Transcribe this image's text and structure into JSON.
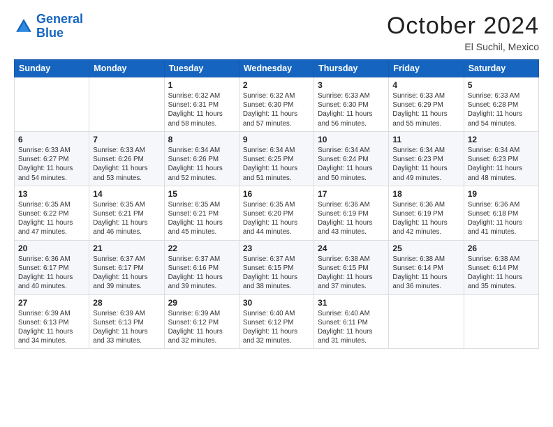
{
  "header": {
    "logo_line1": "General",
    "logo_line2": "Blue",
    "month": "October 2024",
    "location": "El Suchil, Mexico"
  },
  "days_of_week": [
    "Sunday",
    "Monday",
    "Tuesday",
    "Wednesday",
    "Thursday",
    "Friday",
    "Saturday"
  ],
  "weeks": [
    [
      {
        "day": "",
        "empty": true
      },
      {
        "day": "",
        "empty": true
      },
      {
        "day": "1",
        "sunrise": "Sunrise: 6:32 AM",
        "sunset": "Sunset: 6:31 PM",
        "daylight": "Daylight: 11 hours and 58 minutes."
      },
      {
        "day": "2",
        "sunrise": "Sunrise: 6:32 AM",
        "sunset": "Sunset: 6:30 PM",
        "daylight": "Daylight: 11 hours and 57 minutes."
      },
      {
        "day": "3",
        "sunrise": "Sunrise: 6:33 AM",
        "sunset": "Sunset: 6:30 PM",
        "daylight": "Daylight: 11 hours and 56 minutes."
      },
      {
        "day": "4",
        "sunrise": "Sunrise: 6:33 AM",
        "sunset": "Sunset: 6:29 PM",
        "daylight": "Daylight: 11 hours and 55 minutes."
      },
      {
        "day": "5",
        "sunrise": "Sunrise: 6:33 AM",
        "sunset": "Sunset: 6:28 PM",
        "daylight": "Daylight: 11 hours and 54 minutes."
      }
    ],
    [
      {
        "day": "6",
        "sunrise": "Sunrise: 6:33 AM",
        "sunset": "Sunset: 6:27 PM",
        "daylight": "Daylight: 11 hours and 54 minutes."
      },
      {
        "day": "7",
        "sunrise": "Sunrise: 6:33 AM",
        "sunset": "Sunset: 6:26 PM",
        "daylight": "Daylight: 11 hours and 53 minutes."
      },
      {
        "day": "8",
        "sunrise": "Sunrise: 6:34 AM",
        "sunset": "Sunset: 6:26 PM",
        "daylight": "Daylight: 11 hours and 52 minutes."
      },
      {
        "day": "9",
        "sunrise": "Sunrise: 6:34 AM",
        "sunset": "Sunset: 6:25 PM",
        "daylight": "Daylight: 11 hours and 51 minutes."
      },
      {
        "day": "10",
        "sunrise": "Sunrise: 6:34 AM",
        "sunset": "Sunset: 6:24 PM",
        "daylight": "Daylight: 11 hours and 50 minutes."
      },
      {
        "day": "11",
        "sunrise": "Sunrise: 6:34 AM",
        "sunset": "Sunset: 6:23 PM",
        "daylight": "Daylight: 11 hours and 49 minutes."
      },
      {
        "day": "12",
        "sunrise": "Sunrise: 6:34 AM",
        "sunset": "Sunset: 6:23 PM",
        "daylight": "Daylight: 11 hours and 48 minutes."
      }
    ],
    [
      {
        "day": "13",
        "sunrise": "Sunrise: 6:35 AM",
        "sunset": "Sunset: 6:22 PM",
        "daylight": "Daylight: 11 hours and 47 minutes."
      },
      {
        "day": "14",
        "sunrise": "Sunrise: 6:35 AM",
        "sunset": "Sunset: 6:21 PM",
        "daylight": "Daylight: 11 hours and 46 minutes."
      },
      {
        "day": "15",
        "sunrise": "Sunrise: 6:35 AM",
        "sunset": "Sunset: 6:21 PM",
        "daylight": "Daylight: 11 hours and 45 minutes."
      },
      {
        "day": "16",
        "sunrise": "Sunrise: 6:35 AM",
        "sunset": "Sunset: 6:20 PM",
        "daylight": "Daylight: 11 hours and 44 minutes."
      },
      {
        "day": "17",
        "sunrise": "Sunrise: 6:36 AM",
        "sunset": "Sunset: 6:19 PM",
        "daylight": "Daylight: 11 hours and 43 minutes."
      },
      {
        "day": "18",
        "sunrise": "Sunrise: 6:36 AM",
        "sunset": "Sunset: 6:19 PM",
        "daylight": "Daylight: 11 hours and 42 minutes."
      },
      {
        "day": "19",
        "sunrise": "Sunrise: 6:36 AM",
        "sunset": "Sunset: 6:18 PM",
        "daylight": "Daylight: 11 hours and 41 minutes."
      }
    ],
    [
      {
        "day": "20",
        "sunrise": "Sunrise: 6:36 AM",
        "sunset": "Sunset: 6:17 PM",
        "daylight": "Daylight: 11 hours and 40 minutes."
      },
      {
        "day": "21",
        "sunrise": "Sunrise: 6:37 AM",
        "sunset": "Sunset: 6:17 PM",
        "daylight": "Daylight: 11 hours and 39 minutes."
      },
      {
        "day": "22",
        "sunrise": "Sunrise: 6:37 AM",
        "sunset": "Sunset: 6:16 PM",
        "daylight": "Daylight: 11 hours and 39 minutes."
      },
      {
        "day": "23",
        "sunrise": "Sunrise: 6:37 AM",
        "sunset": "Sunset: 6:15 PM",
        "daylight": "Daylight: 11 hours and 38 minutes."
      },
      {
        "day": "24",
        "sunrise": "Sunrise: 6:38 AM",
        "sunset": "Sunset: 6:15 PM",
        "daylight": "Daylight: 11 hours and 37 minutes."
      },
      {
        "day": "25",
        "sunrise": "Sunrise: 6:38 AM",
        "sunset": "Sunset: 6:14 PM",
        "daylight": "Daylight: 11 hours and 36 minutes."
      },
      {
        "day": "26",
        "sunrise": "Sunrise: 6:38 AM",
        "sunset": "Sunset: 6:14 PM",
        "daylight": "Daylight: 11 hours and 35 minutes."
      }
    ],
    [
      {
        "day": "27",
        "sunrise": "Sunrise: 6:39 AM",
        "sunset": "Sunset: 6:13 PM",
        "daylight": "Daylight: 11 hours and 34 minutes."
      },
      {
        "day": "28",
        "sunrise": "Sunrise: 6:39 AM",
        "sunset": "Sunset: 6:13 PM",
        "daylight": "Daylight: 11 hours and 33 minutes."
      },
      {
        "day": "29",
        "sunrise": "Sunrise: 6:39 AM",
        "sunset": "Sunset: 6:12 PM",
        "daylight": "Daylight: 11 hours and 32 minutes."
      },
      {
        "day": "30",
        "sunrise": "Sunrise: 6:40 AM",
        "sunset": "Sunset: 6:12 PM",
        "daylight": "Daylight: 11 hours and 32 minutes."
      },
      {
        "day": "31",
        "sunrise": "Sunrise: 6:40 AM",
        "sunset": "Sunset: 6:11 PM",
        "daylight": "Daylight: 11 hours and 31 minutes."
      },
      {
        "day": "",
        "empty": true
      },
      {
        "day": "",
        "empty": true
      }
    ]
  ]
}
